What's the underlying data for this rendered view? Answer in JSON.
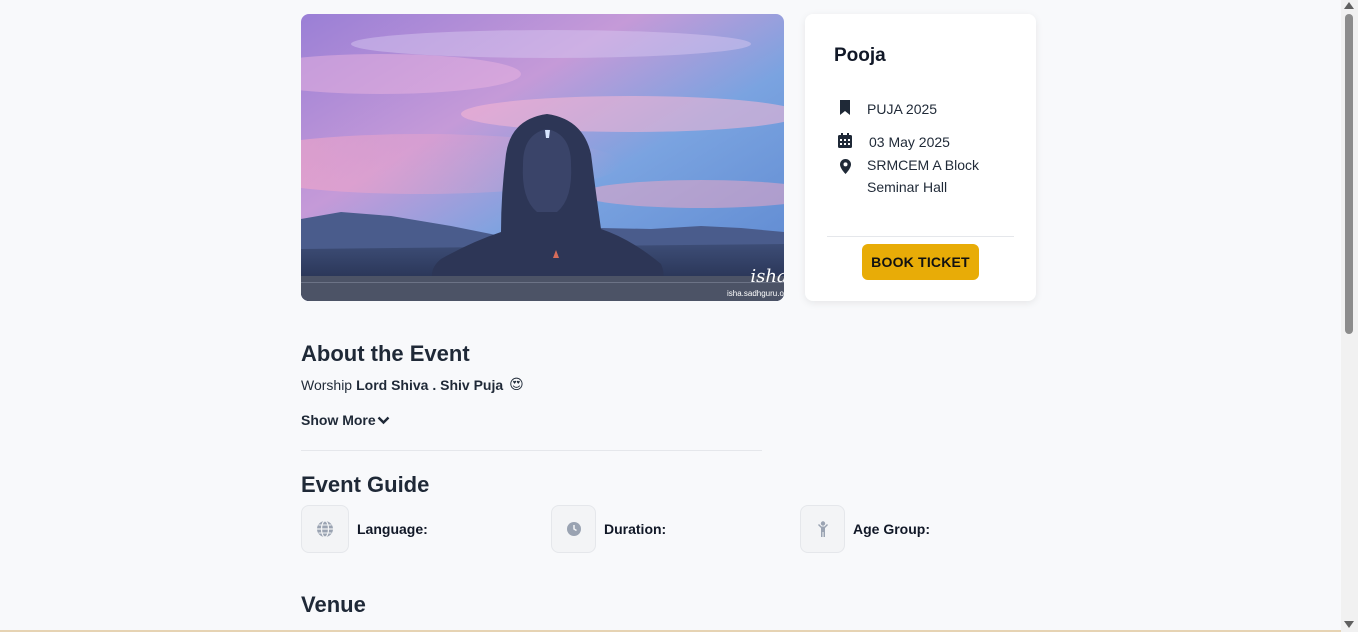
{
  "hero": {
    "image_alt": "Adiyogi Shiva statue at dusk",
    "watermark": "isha.sadhguru.org",
    "logo_text": "isha"
  },
  "card": {
    "title": "Pooja",
    "category": "PUJA 2025",
    "date": "03 May 2025",
    "venue_line1": "SRMCEM A Block",
    "venue_line2": "Seminar Hall",
    "book_label": "BOOK TICKET",
    "icons": [
      "bookmark-icon",
      "calendar-icon",
      "location-pin-icon"
    ]
  },
  "about": {
    "title": "About the Event",
    "text_prefix": "Worship",
    "text_bold": "Lord Shiva . Shiv Puja",
    "emoji": "😍",
    "show_more": "Show More"
  },
  "guide": {
    "title": "Event Guide",
    "items": [
      {
        "label": "Language:",
        "icon": "globe-icon"
      },
      {
        "label": "Duration:",
        "icon": "clock-icon"
      },
      {
        "label": "Age Group:",
        "icon": "person-icon"
      }
    ]
  },
  "venue": {
    "title": "Venue"
  },
  "colors": {
    "accent": "#e8ac07",
    "background": "#f8f9fb",
    "text": "#1f2937"
  }
}
